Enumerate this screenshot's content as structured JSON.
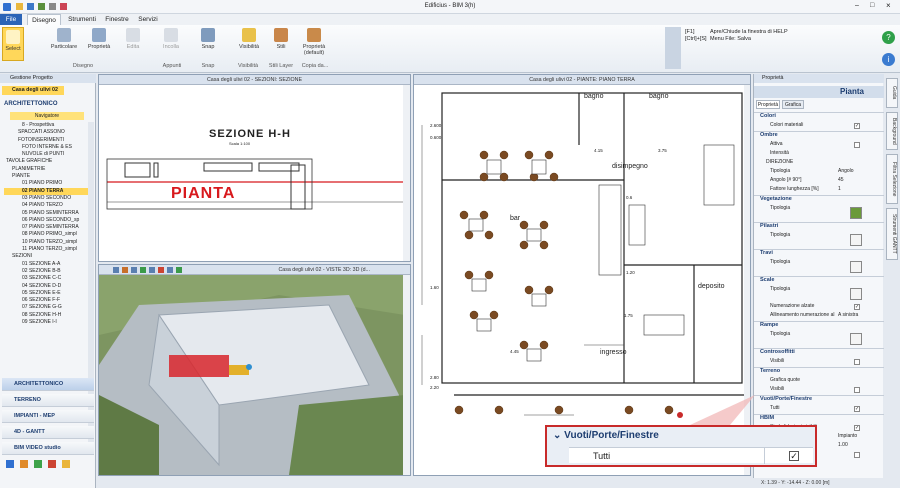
{
  "window_title": "Edificius - BIM 3(h)",
  "menu_tabs": [
    "File",
    "Disegno",
    "Strumenti",
    "Finestre",
    "Servizi"
  ],
  "active_tab": "Disegno",
  "ribbon": {
    "buttons": [
      "Select",
      "Particolare",
      "Proprietà",
      "Edita",
      "Incolla",
      "Snap",
      "Visibilità",
      "Stili",
      "Proprietà (default)"
    ],
    "groups": [
      "Disegno",
      "Appunti",
      "Snap",
      "Visibilità",
      "Stili Layer",
      "Copia da..."
    ],
    "help_keys": "[F1]\n[Ctrl]+[S]",
    "help_lines": [
      "Apre/Chiude la finestra di HELP",
      "Menu File: Salva"
    ]
  },
  "left_panel": {
    "title": "Gestione Progetto",
    "project": "Casa degli ulivi 02",
    "section": "ARCHITETTONICO",
    "navigator": "Navigatore",
    "tree": [
      "8 - Prospettiva",
      "SPACCATI ASSONO",
      "FOTOINSERIMENTI",
      "FOTO INTERNE & ES",
      "NUVOLE di PUNTI",
      "TAVOLE GRAFICHE",
      "PLANIMETRIE",
      "PIANTE",
      "01 PIANO PRIMO",
      "02 PIANO TERRA",
      "03 PIANO SECONDO",
      "04 PIANO TERZO",
      "05 PIANO SEMINTERRA",
      "06 PIANO SECONDO_sp",
      "07 PIANO SEMINTERRA",
      "08 PIANO PRIMO_simpl",
      "10 PIANO TERZO_simpl",
      "11 PIANO TERZO_simpl",
      "SEZIONI",
      "01 SEZIONE A-A",
      "02 SEZIONE B-B",
      "03 SEZIONE C-C",
      "04 SEZIONE D-D",
      "05 SEZIONE E-E",
      "06 SEZIONE F-F",
      "07 SEZIONE G-G",
      "08 SEZIONE H-H",
      "09 SEZIONE I-I"
    ],
    "selected_tree_item": "02 PIANO TERRA",
    "bottom_buttons": [
      "ARCHITETTONICO",
      "TERRENO",
      "IMPIANTI - MEP",
      "4D - GANTT",
      "BIM VIDEO studio"
    ]
  },
  "windows": {
    "section": {
      "title": "Casa degli ulivi 02 - SEZIONI: SEZIONE",
      "heading": "SEZIONE  H-H",
      "scale": "Scala 1:100",
      "pianta_label": "PIANTA"
    },
    "view3d": {
      "title": "Casa degli ulivi 02 - VISTE 3D: 3D (d..."
    },
    "plan": {
      "title": "Casa degli ulivi 02 - PIANTE: PIANO TERRA",
      "rooms": [
        "bagno",
        "bagno",
        "disimpegno",
        "bar",
        "deposito",
        "ingresso"
      ],
      "dims": [
        "2.600",
        "0.600",
        "4.15",
        "3.75",
        "0.6",
        "4.45",
        "1.75",
        "1.60",
        "2.80",
        "2.20",
        "1.20"
      ]
    }
  },
  "properties": {
    "panel_title": "Proprietà",
    "header": "Pianta",
    "tabs": [
      "Proprietà",
      "Grafica"
    ],
    "rows": [
      {
        "label": "Colori",
        "type": "cat"
      },
      {
        "label": "Colori materiali",
        "check": true
      },
      {
        "label": "Ombre",
        "type": "cat"
      },
      {
        "label": "Attiva",
        "check": false
      },
      {
        "label": "Intensità",
        "value": ""
      },
      {
        "label": "DIREZIONE",
        "type": "sub"
      },
      {
        "label": "Tipologia",
        "value": "Angolo"
      },
      {
        "label": "Angolo [# 90°]",
        "value": "45"
      },
      {
        "label": "Fattore lunghezza [%]",
        "value": "1"
      },
      {
        "label": "Vegetazione",
        "type": "cat"
      },
      {
        "label": "Tipologia",
        "value": "tree"
      },
      {
        "label": "Pilastri",
        "type": "cat"
      },
      {
        "label": "Tipologia",
        "value": "hatch"
      },
      {
        "label": "Travi",
        "type": "cat"
      },
      {
        "label": "Tipologia",
        "value": "hatch"
      },
      {
        "label": "Scale",
        "type": "cat"
      },
      {
        "label": "Tipologia",
        "value": "stair"
      },
      {
        "label": "Numerazione alzate",
        "check": true
      },
      {
        "label": "Allineamento numerazione al",
        "value": "A sinistra"
      },
      {
        "label": "Rampe",
        "type": "cat"
      },
      {
        "label": "Tipologia",
        "value": "ramp"
      },
      {
        "label": "Controsoffitti",
        "type": "cat"
      },
      {
        "label": "Visibili",
        "check": false
      },
      {
        "label": "Terreno",
        "type": "cat"
      },
      {
        "label": "Grafica quote",
        "value": ""
      },
      {
        "label": "Visibili",
        "check": false
      },
      {
        "label": "Vuoti/Porte/Finestre",
        "type": "cat"
      },
      {
        "label": "Tutti",
        "check": true
      },
      {
        "label": "HBIM",
        "type": "cat"
      },
      {
        "label": "Simboli lesioni visibili",
        "check": true
      },
      {
        "label": "",
        "value": "Impianto"
      },
      {
        "label": "",
        "value": "1.00"
      },
      {
        "label": "Profili visibili",
        "check": false
      }
    ]
  },
  "right_tabs": [
    "Guida",
    "Background",
    "Filtra Selezione",
    "Strumenti GANTT"
  ],
  "callout": {
    "category": "Vuoti/Porte/Finestre",
    "item": "Tutti",
    "checked": true
  },
  "status": "X: 1.39 - Y: -14.44 - Z: 0.00 [m]",
  "colors": {
    "accent": "#1d3d70",
    "highlight": "#ffd75a",
    "callout_border": "#c82a2a",
    "pianta_red": "#d8191d"
  }
}
